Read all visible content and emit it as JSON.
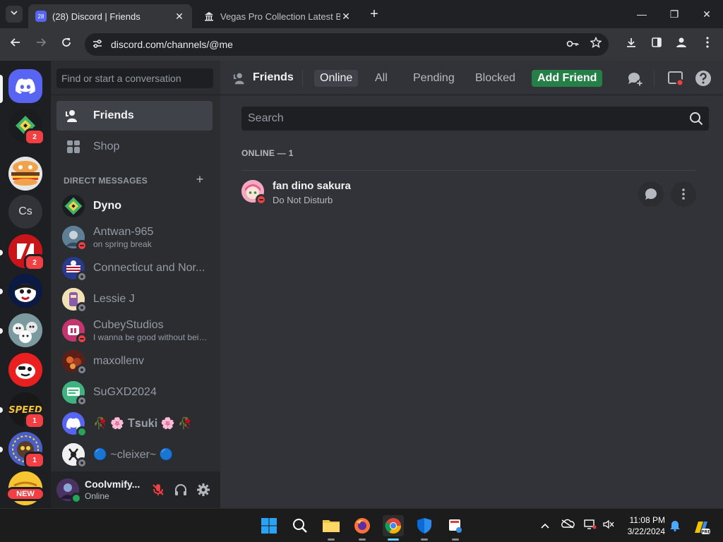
{
  "browser": {
    "tabs": [
      {
        "title": "(28) Discord | Friends",
        "favicon_badge": "28",
        "active": true
      },
      {
        "title": "Vegas Pro Collection Latest Buil",
        "active": false
      }
    ],
    "new_tab": "+",
    "url": "discord.com/channels/@me"
  },
  "guilds": {
    "home_icon": "discord-logo-icon",
    "servers": [
      {
        "name": "dyno-server",
        "badge": "2"
      },
      {
        "name": "burger-server"
      },
      {
        "name": "Cs",
        "initials": "Cs"
      },
      {
        "name": "slash-server",
        "badge": "2",
        "unread": true
      },
      {
        "name": "face-server",
        "unread": true
      },
      {
        "name": "group-server",
        "unread": true
      },
      {
        "name": "red-mascot-server"
      },
      {
        "name": "speed-server",
        "badge": "1",
        "unread": true
      },
      {
        "name": "creature-server",
        "badge": "1",
        "unread": true
      },
      {
        "name": "new-server",
        "tag": "NEW"
      }
    ]
  },
  "sidebar": {
    "search_placeholder": "Find or start a conversation",
    "nav": [
      {
        "label": "Friends",
        "icon": "friends-icon",
        "selected": true
      },
      {
        "label": "Shop",
        "icon": "shop-icon"
      }
    ],
    "dm_header": "DIRECT MESSAGES",
    "dm_add": "+",
    "dms": [
      {
        "name": "Dyno",
        "status": null,
        "bold": true
      },
      {
        "name": "Antwan-965",
        "sub": "on spring break",
        "status": "dnd"
      },
      {
        "name": "Connecticut and Nor...",
        "status": "offline"
      },
      {
        "name": "Lessie J",
        "status": "offline"
      },
      {
        "name": "CubeyStudios",
        "sub": "I wanna be good without bein...",
        "status": "dnd"
      },
      {
        "name": "maxollenv",
        "status": "offline"
      },
      {
        "name": "SuGXD2024",
        "status": "offline"
      },
      {
        "name": "🥀 🌸 𝐓𝐬𝐮𝐤𝐢 🌸 🥀",
        "status": "online"
      },
      {
        "name": "🔵 ~cleixer~ 🔵",
        "status": "offline"
      }
    ]
  },
  "user_panel": {
    "username": "Coolvmify...",
    "status": "Online"
  },
  "friends_header": {
    "title": "Friends",
    "tabs": [
      "Online",
      "All",
      "Pending",
      "Blocked"
    ],
    "selected_tab": "Online",
    "add_friend": "Add Friend"
  },
  "friends_main": {
    "search_placeholder": "Search",
    "online_header": "ONLINE — 1",
    "friends": [
      {
        "name": "fan dino sakura",
        "status": "Do Not Disturb"
      }
    ]
  },
  "taskbar": {
    "time": "11:08 PM",
    "date": "3/22/2024"
  },
  "colors": {
    "blurple": "#5865f2",
    "green": "#248046",
    "red": "#f23f43",
    "bg_main": "#313338",
    "bg_sidebar": "#2b2d31",
    "bg_guilds": "#1e1f22"
  }
}
